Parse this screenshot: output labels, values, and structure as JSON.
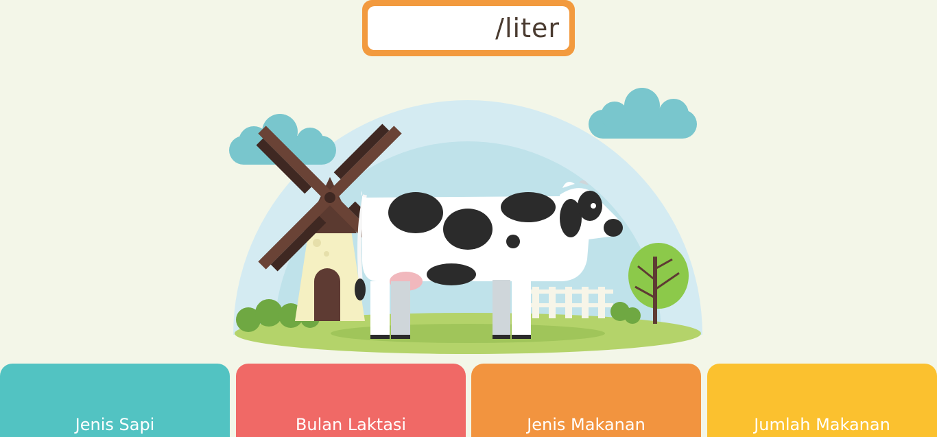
{
  "result": {
    "value": "",
    "unit": "/liter"
  },
  "illustration": {
    "subject": "cow-farm-scene"
  },
  "cards": [
    {
      "label": "Jenis Sapi",
      "color": "#52c3c2"
    },
    {
      "label": "Bulan Laktasi",
      "color": "#f06966"
    },
    {
      "label": "Jenis Makanan",
      "color": "#f2943f"
    },
    {
      "label": "Jumlah Makanan",
      "color": "#fbc12f"
    }
  ],
  "colors": {
    "background": "#f3f6e8",
    "accent": "#f29a3e"
  }
}
